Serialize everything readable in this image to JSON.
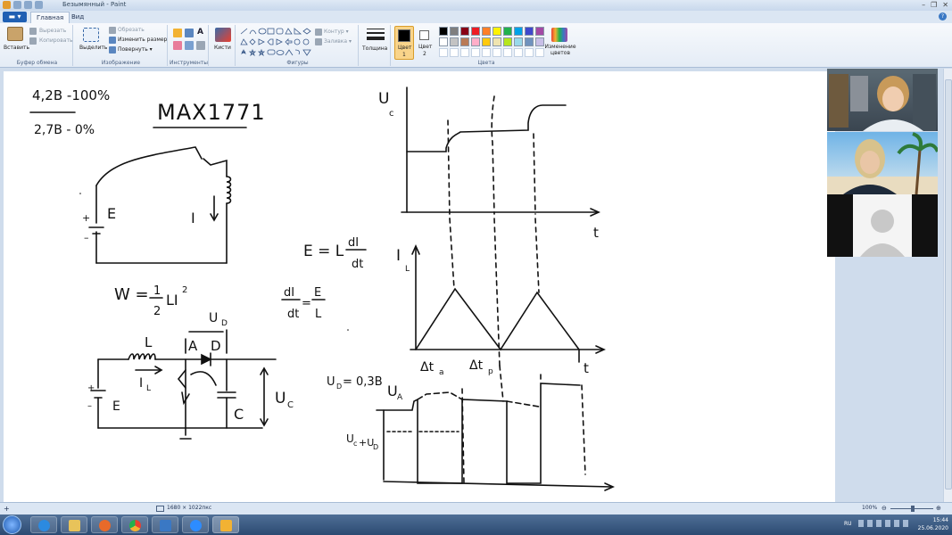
{
  "window": {
    "title": "Безымянный - Paint",
    "controls": [
      "–",
      "❐",
      "✕"
    ]
  },
  "menu": {
    "file_button": "▬ ▾"
  },
  "tabs": [
    {
      "label": "Главная",
      "active": true
    },
    {
      "label": "Вид",
      "active": false
    }
  ],
  "ribbon": {
    "clipboard": {
      "paste": "Вставить",
      "cut": "Вырезать",
      "copy": "Копировать",
      "label": "Буфер обмена"
    },
    "image": {
      "select": "Выделить",
      "crop": "Обрезать",
      "resize": "Изменить размер",
      "rotate": "Повернуть ▾",
      "label": "Изображение"
    },
    "tools": {
      "label": "Инструменты",
      "text_tool": "A"
    },
    "brushes": {
      "label": "Кисти"
    },
    "shapes": {
      "outline": "Контур ▾",
      "fill": "Заливка ▾",
      "label": "Фигуры"
    },
    "size": {
      "label": "Толщина"
    },
    "colors": {
      "color1": "Цвет\n1",
      "color1_a": "Цвет",
      "color1_b": "1",
      "color2_a": "Цвет",
      "color2_b": "2",
      "edit": "Изменение цветов",
      "label": "Цвета",
      "palette_row1": [
        "#000000",
        "#7f7f7f",
        "#880015",
        "#ed1c24",
        "#ff7f27",
        "#fff200",
        "#22b14c",
        "#00a2e8",
        "#3f48cc",
        "#a349a4"
      ],
      "palette_row2": [
        "#ffffff",
        "#c3c3c3",
        "#b97a57",
        "#ffaec9",
        "#ffc90e",
        "#efe4b0",
        "#b5e61d",
        "#99d9ea",
        "#7092be",
        "#c8bfe7"
      ]
    }
  },
  "drawing": {
    "ratio_top": "4,2В -100%",
    "ratio_bottom": "2,7В - 0%",
    "chip": "MAX1771",
    "e_label": "E",
    "i_label": "I",
    "w_formula_lhs": "W =",
    "w_half_num": "1",
    "w_half_den": "2",
    "w_rest": "LI",
    "w_exp": "2",
    "e_formula_lhs": "E = L",
    "di": "dI",
    "dt": "dt",
    "didt_num": "dI",
    "didt_den": "dt",
    "didt_eq": "=",
    "el_num": "E",
    "el_den": "L",
    "L_label": "L",
    "A_label": "A",
    "D_label": "D",
    "UD_label": "U",
    "UD_sub": "D",
    "IL_label": "I",
    "IL_sub": "L",
    "E2_label": "E",
    "C_label": "C",
    "UC_label": "U",
    "UC_sub": "C",
    "plot1_y": "U",
    "plot1_ysub": "c",
    "plot1_x": "t",
    "plot2_y": "I",
    "plot2_ysub": "L",
    "plot2_x": "t",
    "ta": "Δt",
    "ta_sub": "a",
    "tp": "Δt",
    "tp_sub": "p",
    "ud_note": "U",
    "ud_note_sub": "D",
    "ud_note_val": "= 0,3В",
    "plot3_y": "U",
    "plot3_ysub": "A",
    "plot3_left": "U",
    "plot3_left_sub": "c",
    "plot3_left2": "+U",
    "plot3_left2_sub": "D",
    "plot3_x": "t"
  },
  "status": {
    "size": "1680 × 1022пкс",
    "zoom": "100%"
  },
  "tray": {
    "lang": "RU",
    "time": "15:44",
    "date": "25.06.2020"
  }
}
